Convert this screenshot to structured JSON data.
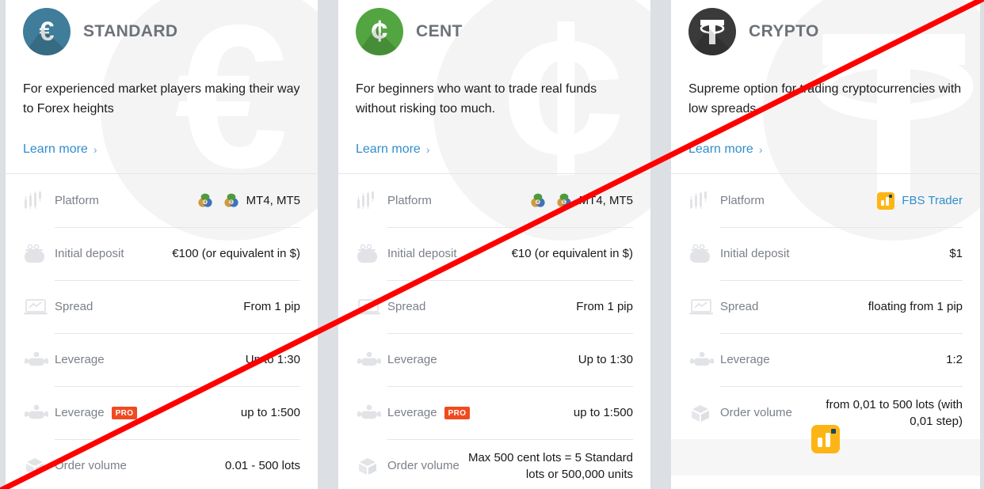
{
  "colors": {
    "page_background": "#dcdfe3",
    "card_background": "#ffffff",
    "standard_accent": "#3f7d9a",
    "cent_accent": "#52a540",
    "crypto_accent": "#3a3a3a",
    "link": "#2f8ecd",
    "pro_badge": "#f04a21",
    "fbs_orange": "#fdb515",
    "annotation_line": "#ff0000"
  },
  "annotation": {
    "name": "red-diagonal-line",
    "from": "bottom-left",
    "to": "top-right"
  },
  "cards": [
    {
      "id": "standard",
      "title": "STANDARD",
      "icon_name": "euro-coin-icon",
      "icon_glyph": "€",
      "description": "For experienced market players making their way to Forex heights",
      "learn_more": "Learn more",
      "chevron": "›",
      "watermark_glyph": "€",
      "footer_badge": false,
      "rows": [
        {
          "icon": "candlestick-chart-icon",
          "label": "Platform",
          "value": "MT4, MT5",
          "value_icons": [
            "mt4-icon",
            "mt5-icon"
          ],
          "pro": false
        },
        {
          "icon": "wallet-icon",
          "label": "Initial deposit",
          "value": "€100 (or equivalent in $)",
          "value_icons": [],
          "pro": false
        },
        {
          "icon": "laptop-chart-icon",
          "label": "Spread",
          "value": "From 1 pip",
          "value_icons": [],
          "pro": false
        },
        {
          "icon": "strong-arm-icon",
          "label": "Leverage",
          "value": "Up to 1:30",
          "value_icons": [],
          "pro": false
        },
        {
          "icon": "strong-arm-icon",
          "label": "Leverage",
          "value": "up to 1:500",
          "value_icons": [],
          "pro": true,
          "pro_label": "PRO"
        },
        {
          "icon": "open-box-icon",
          "label": "Order volume",
          "value": "0.01 - 500 lots",
          "value_icons": [],
          "pro": false
        }
      ]
    },
    {
      "id": "cent",
      "title": "CENT",
      "icon_name": "cent-coin-icon",
      "icon_glyph": "¢",
      "description": "For beginners who want to trade real funds without risking too much.",
      "learn_more": "Learn more",
      "chevron": "›",
      "watermark_glyph": "¢",
      "footer_badge": false,
      "rows": [
        {
          "icon": "candlestick-chart-icon",
          "label": "Platform",
          "value": "MT4, MT5",
          "value_icons": [
            "mt4-icon",
            "mt5-icon"
          ],
          "pro": false
        },
        {
          "icon": "wallet-icon",
          "label": "Initial deposit",
          "value": "€10 (or equivalent in $)",
          "value_icons": [],
          "pro": false
        },
        {
          "icon": "laptop-chart-icon",
          "label": "Spread",
          "value": "From 1 pip",
          "value_icons": [],
          "pro": false
        },
        {
          "icon": "strong-arm-icon",
          "label": "Leverage",
          "value": "Up to 1:30",
          "value_icons": [],
          "pro": false
        },
        {
          "icon": "strong-arm-icon",
          "label": "Leverage",
          "value": "up to 1:500",
          "value_icons": [],
          "pro": true,
          "pro_label": "PRO"
        },
        {
          "icon": "open-box-icon",
          "label": "Order volume",
          "value": "Max 500 cent lots = 5 Standard lots or 500,000 units",
          "value_icons": [],
          "pro": false
        }
      ]
    },
    {
      "id": "crypto",
      "title": "CRYPTO",
      "icon_name": "tether-coin-icon",
      "icon_glyph": "₮",
      "description": "Supreme option for trading cryptocurrencies with low spreads",
      "learn_more": "Learn more",
      "chevron": "›",
      "watermark_glyph": "₮",
      "footer_badge": true,
      "footer_badge_name": "fbs-trader-app-icon",
      "rows": [
        {
          "icon": "candlestick-chart-icon",
          "label": "Platform",
          "value": "FBS Trader",
          "value_icons": [
            "fbs-trader-icon"
          ],
          "pro": false
        },
        {
          "icon": "wallet-icon",
          "label": "Initial deposit",
          "value": "$1",
          "value_icons": [],
          "pro": false
        },
        {
          "icon": "laptop-chart-icon",
          "label": "Spread",
          "value": "floating from 1 pip",
          "value_icons": [],
          "pro": false
        },
        {
          "icon": "strong-arm-icon",
          "label": "Leverage",
          "value": "1:2",
          "value_icons": [],
          "pro": false
        },
        {
          "icon": "open-box-icon",
          "label": "Order volume",
          "value": "from 0,01 to 500 lots (with 0,01 step)",
          "value_icons": [],
          "pro": false
        }
      ]
    }
  ]
}
